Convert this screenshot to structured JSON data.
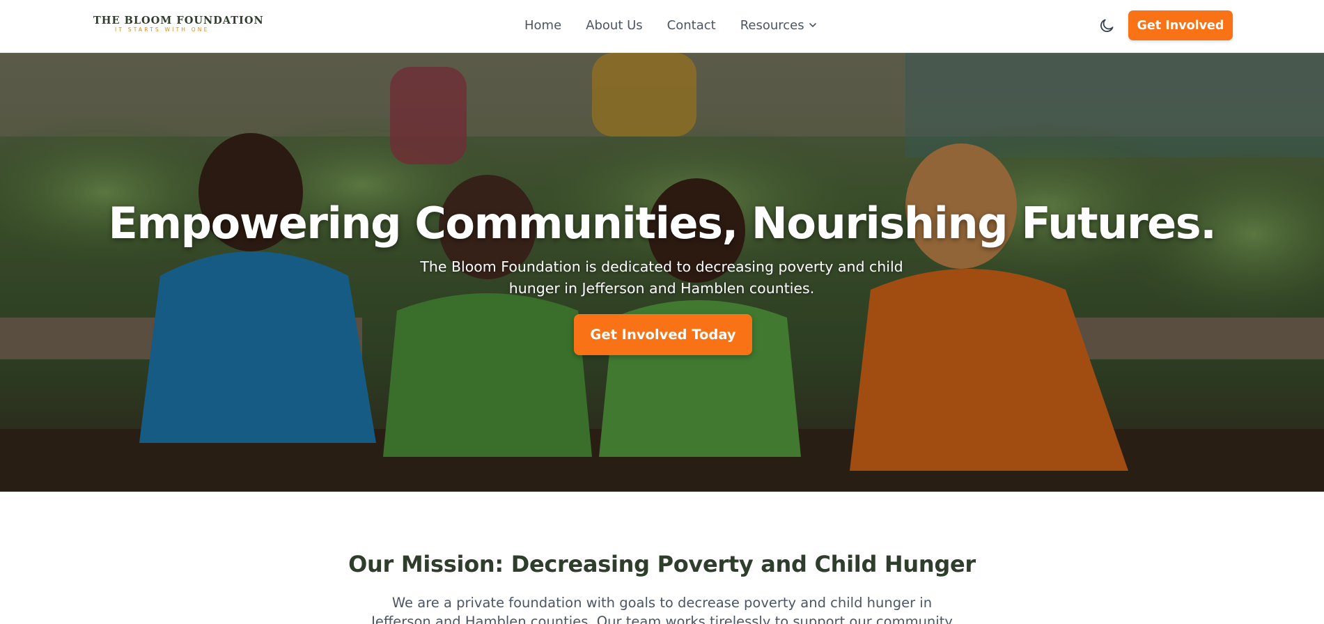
{
  "header": {
    "logo": {
      "name": "THE BLOOM FOUNDATION",
      "tagline": "IT STARTS WITH ONE"
    },
    "nav": [
      {
        "label": "Home"
      },
      {
        "label": "About Us"
      },
      {
        "label": "Contact"
      },
      {
        "label": "Resources",
        "icon": "chevron-down-icon"
      }
    ],
    "theme_toggle_icon": "moon-icon",
    "cta_label": "Get Involved"
  },
  "hero": {
    "title": "Empowering Communities, Nourishing Futures.",
    "subtitle": "The Bloom Foundation is dedicated to decreasing poverty and child hunger in Jefferson and Hamblen counties.",
    "cta_label": "Get Involved Today",
    "background": "photo of children planting in raised garden beds"
  },
  "mission": {
    "title": "Our Mission: Decreasing Poverty and Child Hunger",
    "body": "We are a private foundation with goals to decrease poverty and child hunger in Jefferson and Hamblen counties. Our team works tirelessly to support our community through"
  },
  "colors": {
    "accent": "#f97316",
    "heading": "#2f3d2c",
    "logo_tagline": "#e38a12",
    "nav_text": "#4b5563"
  }
}
